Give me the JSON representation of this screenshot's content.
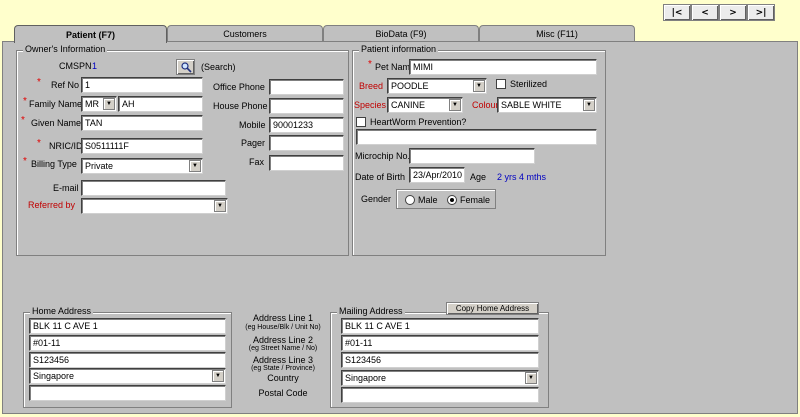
{
  "nav": {
    "first": "|<",
    "prev": "<",
    "next": ">",
    "last": ">|"
  },
  "tabs": [
    {
      "label": "Patient (F7)"
    },
    {
      "label": "Customers"
    },
    {
      "label": "BioData (F9)"
    },
    {
      "label": "Misc (F11)"
    }
  ],
  "owner": {
    "title": "Owner's Information",
    "cmspn_label": "CMSPN",
    "cmspn_value": "1",
    "search_label": "(Search)",
    "ref_no_label": "Ref No",
    "ref_no_value": "1",
    "family_name_label": "Family Name",
    "salutation_value": "MR",
    "family_name_value": "AH",
    "given_name_label": "Given Name",
    "given_name_value": "TAN",
    "nric_label": "NRIC/ID",
    "nric_value": "S0511111F",
    "billing_type_label": "Billing Type",
    "billing_type_value": "Private",
    "email_label": "E-mail",
    "email_value": "",
    "referred_by_label": "Referred by",
    "referred_by_value": "",
    "office_phone_label": "Office Phone",
    "office_phone_value": "",
    "house_phone_label": "House Phone",
    "house_phone_value": "",
    "mobile_label": "Mobile",
    "mobile_value": "90001233",
    "pager_label": "Pager",
    "pager_value": "",
    "fax_label": "Fax",
    "fax_value": ""
  },
  "patient": {
    "title": "Patient information",
    "pet_name_label": "Pet Name",
    "pet_name_value": "MIMI",
    "breed_label": "Breed",
    "breed_value": "POODLE",
    "sterilized_label": "Sterilized",
    "species_label": "Species",
    "species_value": "CANINE",
    "colour_label": "Colour",
    "colour_value": "SABLE WHITE",
    "heartworm_label": "HeartWorm Prevention?",
    "heartworm_notes": "",
    "microchip_label": "Microchip No.",
    "microchip_value": "",
    "dob_label": "Date of Birth",
    "dob_value": "23/Apr/2010",
    "age_label": "Age",
    "age_value": "2 yrs 4 mths",
    "gender_label": "Gender",
    "male_label": "Male",
    "female_label": "Female"
  },
  "home_address": {
    "title": "Home Address",
    "line1": "BLK 11 C AVE 1",
    "line2": "#01-11",
    "line3": "S123456",
    "country": "Singapore",
    "postal_code": ""
  },
  "address_labels": {
    "line1": "Address Line 1",
    "line1_hint": "(eg House/Blk / Unit No)",
    "line2": "Address Line 2",
    "line2_hint": "(eg Street Name / No)",
    "line3": "Address Line 3",
    "line3_hint": "(eg State / Province)",
    "country": "Country",
    "postal_code": "Postal Code"
  },
  "mailing_address": {
    "title": "Mailing Address",
    "copy_button": "Copy Home Address",
    "line1": "BLK 11 C AVE 1",
    "line2": "#01-11",
    "line3": "S123456",
    "country": "Singapore",
    "postal_code": ""
  },
  "colors": {
    "background": "#ffffcc",
    "panel": "#c0c0c0",
    "required": "#c00000",
    "value_blue": "#0000c0"
  }
}
